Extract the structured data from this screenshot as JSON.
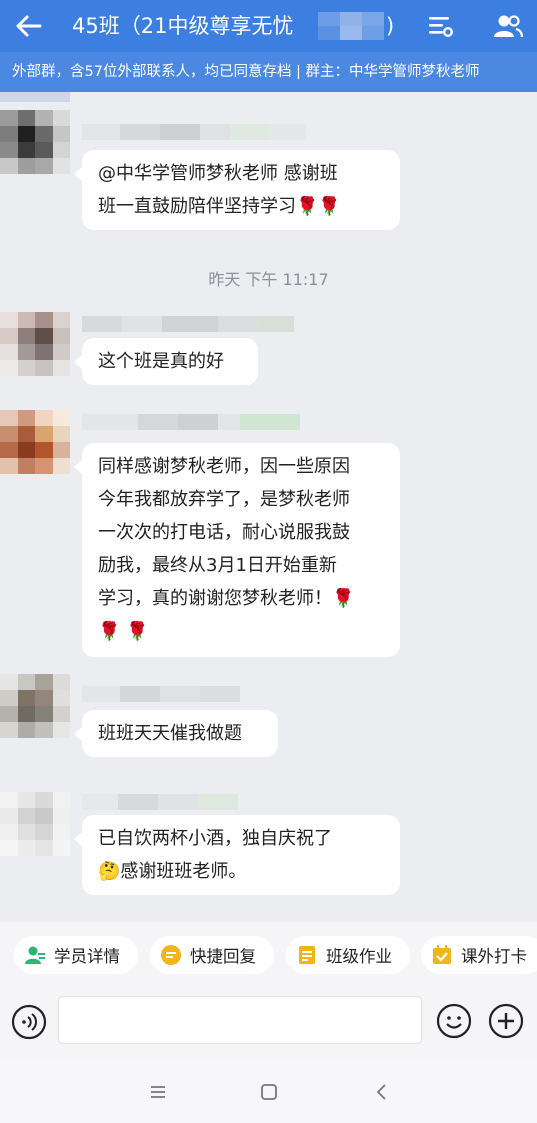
{
  "header": {
    "title": "45班（21中级尊享无忧",
    "title_tail": ")",
    "accent": "#3d7fe0"
  },
  "subbar": {
    "text": "外部群，含57位外部联系人，均已同意存档 | 群主：中华学管师梦秋老师"
  },
  "messages": [
    {
      "text_line1": "@中华学管师梦秋老师 感谢班",
      "text_line2": "班一直鼓励陪伴坚持学习🌹🌹"
    },
    {
      "text": "这个班是真的好"
    },
    {
      "lines": [
        "同样感谢梦秋老师，因一些原因",
        "今年我都放弃学了，是梦秋老师",
        "一次次的打电话，耐心说服我鼓",
        "励我，最终从3月1日开始重新",
        "学习，真的谢谢您梦秋老师！🌹",
        "🌹 🌹"
      ]
    },
    {
      "text": "班班天天催我做题"
    },
    {
      "text_line1": "已自饮两杯小酒，独自庆祝了",
      "text_line2": "🤔感谢班班老师。"
    }
  ],
  "timestamp": "昨天  下午 11:17",
  "quick_actions": [
    {
      "label": "学员详情",
      "icon": "user-card-icon"
    },
    {
      "label": "快捷回复",
      "icon": "quick-reply-icon"
    },
    {
      "label": "班级作业",
      "icon": "homework-icon"
    },
    {
      "label": "课外打卡",
      "icon": "calendar-checkin-icon"
    }
  ],
  "input": {
    "placeholder": ""
  }
}
